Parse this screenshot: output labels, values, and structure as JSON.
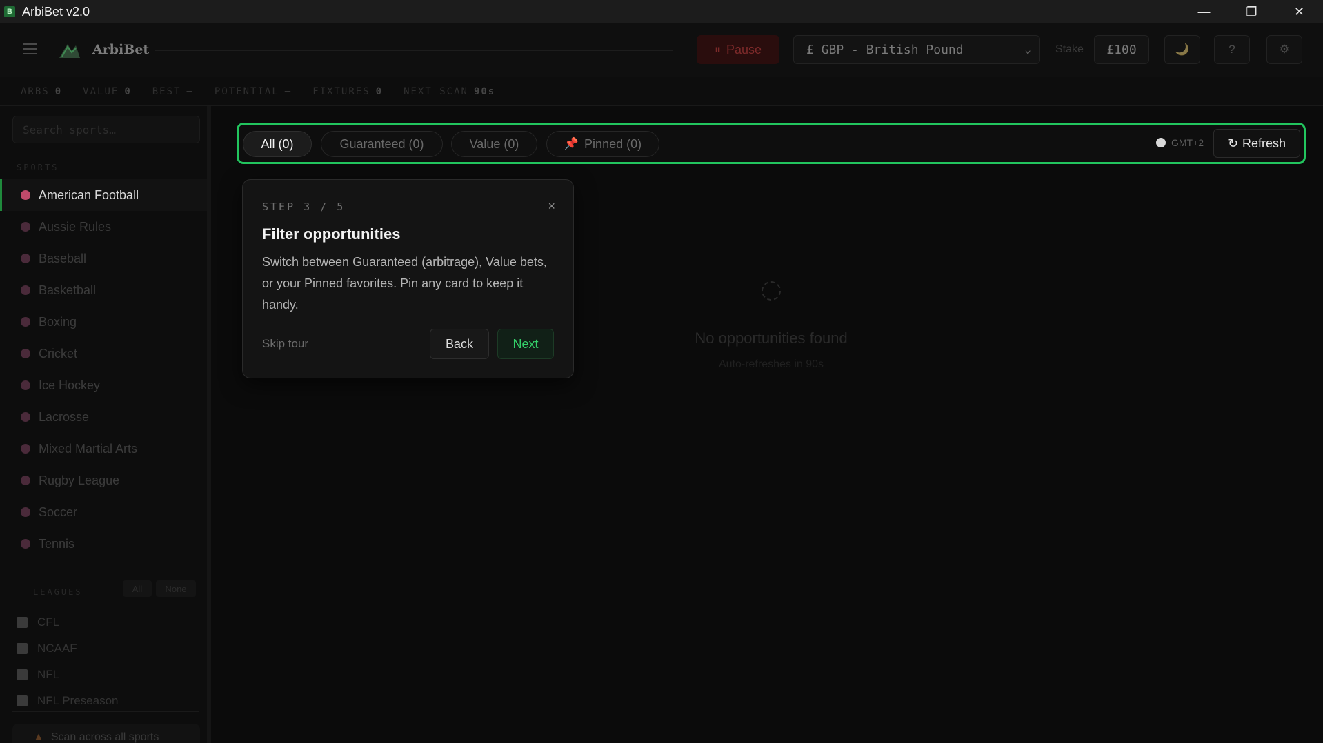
{
  "window": {
    "title": "ArbiBet v2.0",
    "logo_letter": "B",
    "minimize": "—",
    "restore": "❐",
    "close": "✕"
  },
  "header": {
    "brand": "ArbiBet",
    "pause_icon": "⏸",
    "pause_label": "Pause",
    "currency_value": "£ GBP - British Pound",
    "stake_label": "Stake",
    "stake_value": "£100",
    "theme_icon": "🌙",
    "help_icon": "?",
    "settings_icon": "⚙"
  },
  "stats": [
    {
      "label": "ARBS",
      "value": "0"
    },
    {
      "label": "VALUE",
      "value": "0"
    },
    {
      "label": "BEST",
      "value": "—"
    },
    {
      "label": "POTENTIAL",
      "value": "—"
    },
    {
      "label": "FIXTURES",
      "value": "0"
    },
    {
      "label": "NEXT SCAN",
      "value": "90s"
    }
  ],
  "sidebar": {
    "search_placeholder": "Search sports…",
    "sports_label": "SPORTS",
    "sports": [
      "American Football",
      "Aussie Rules",
      "Baseball",
      "Basketball",
      "Boxing",
      "Cricket",
      "Ice Hockey",
      "Lacrosse",
      "Mixed Martial Arts",
      "Rugby League",
      "Soccer",
      "Tennis"
    ],
    "leagues_label": "LEAGUES",
    "leagues_all": "All",
    "leagues_none": "None",
    "leagues": [
      "CFL",
      "NCAAF",
      "NFL",
      "NFL Preseason"
    ],
    "scan_all_label": "Scan across all sports"
  },
  "filters": {
    "all": "All (0)",
    "guaranteed": "Guaranteed (0)",
    "value": "Value (0)",
    "pinned": "Pinned (0)",
    "pin_icon": "📌",
    "timezone": "GMT+2",
    "refresh_label": "Refresh",
    "refresh_icon": "↻"
  },
  "empty": {
    "title": "No opportunities found",
    "subtitle": "Auto-refreshes in 90s"
  },
  "tour": {
    "step": "STEP 3 / 5",
    "close": "×",
    "title": "Filter opportunities",
    "body": "Switch between Guaranteed (arbitrage), Value bets, or your Pinned favorites. Pin any card to keep it handy.",
    "skip": "Skip tour",
    "back": "Back",
    "next": "Next"
  }
}
